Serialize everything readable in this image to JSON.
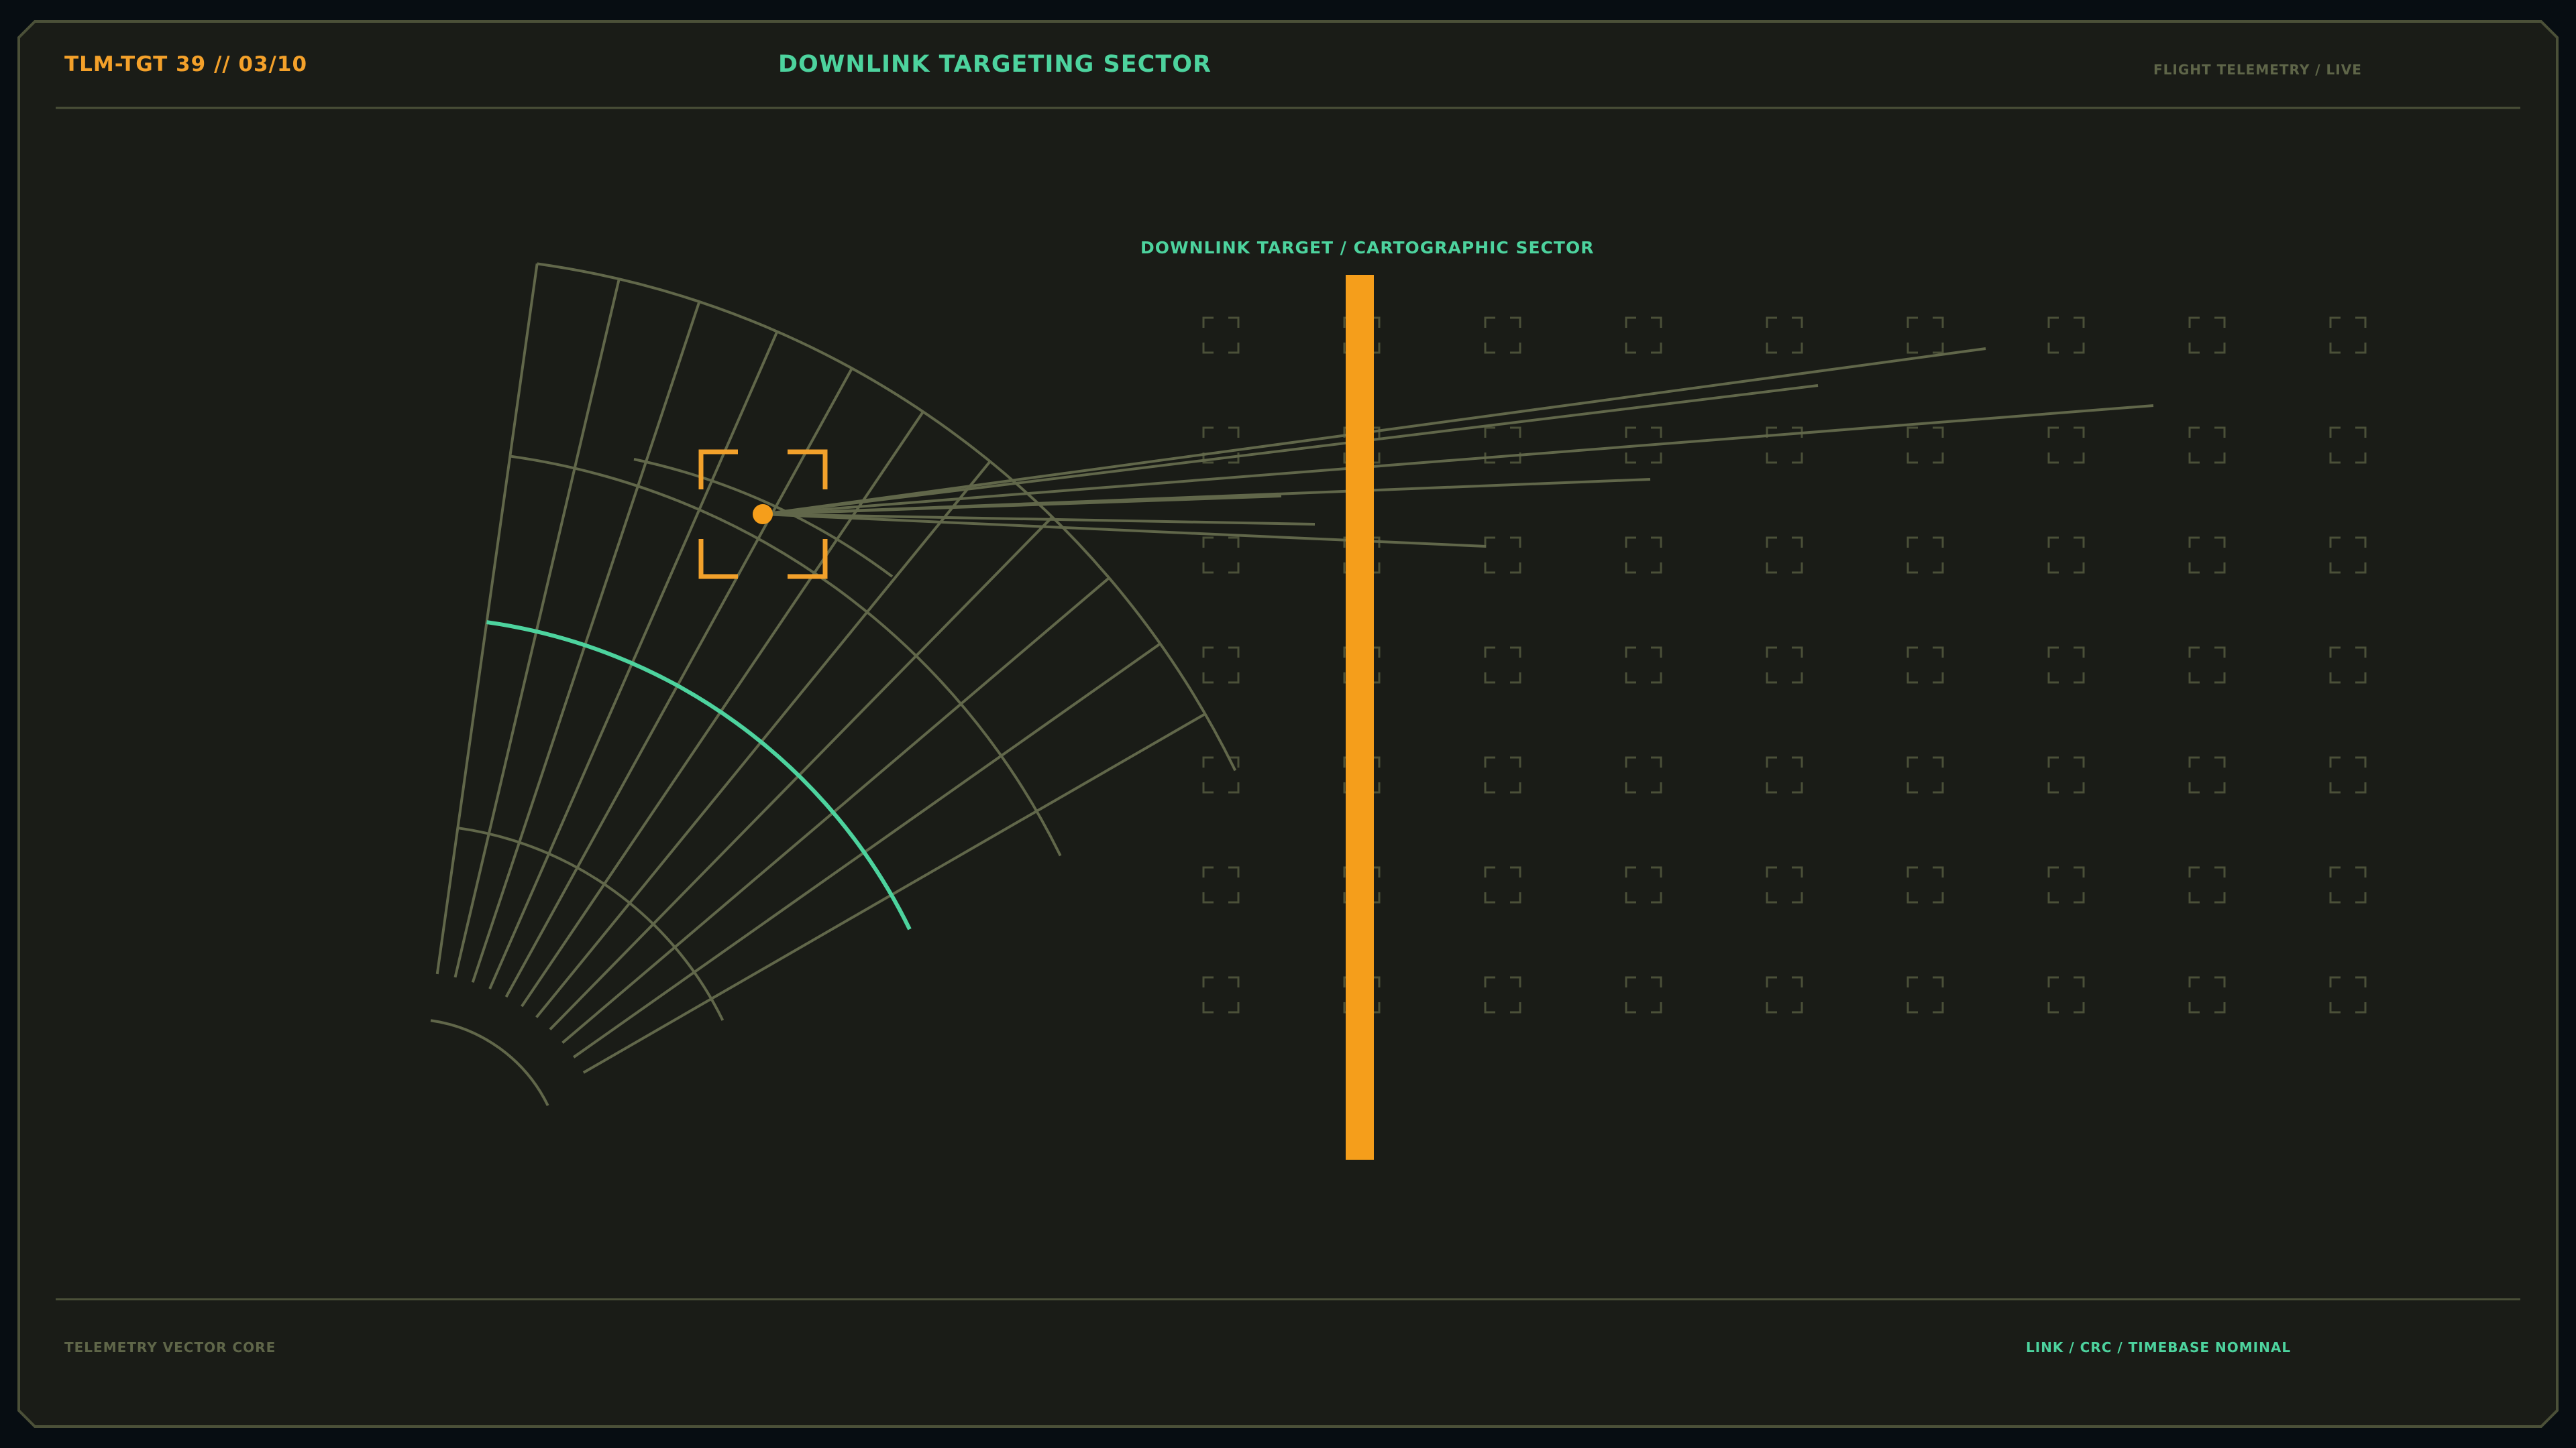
{
  "header": {
    "tag_id": "TLM-TGT 39 // 03/10",
    "title": "DOWNLINK TARGETING SECTOR",
    "status": "FLIGHT TELEMETRY / LIVE"
  },
  "map": {
    "sector_label": "DOWNLINK TARGET / CARTOGRAPHIC SECTOR",
    "target_marker": "crosshair-target-icon",
    "grid_markers": "corner-bracket-icon",
    "grid_columns": 9,
    "grid_rows": 7
  },
  "footer": {
    "left_label": "TELEMETRY VECTOR CORE",
    "right_label": "LINK / CRC / TIMEBASE NOMINAL"
  },
  "colors": {
    "background": "#1a1c17",
    "frame": "#4b5038",
    "grid_line": "#61674a",
    "accent_orange": "#f59e1b",
    "accent_green": "#4dd39e"
  }
}
